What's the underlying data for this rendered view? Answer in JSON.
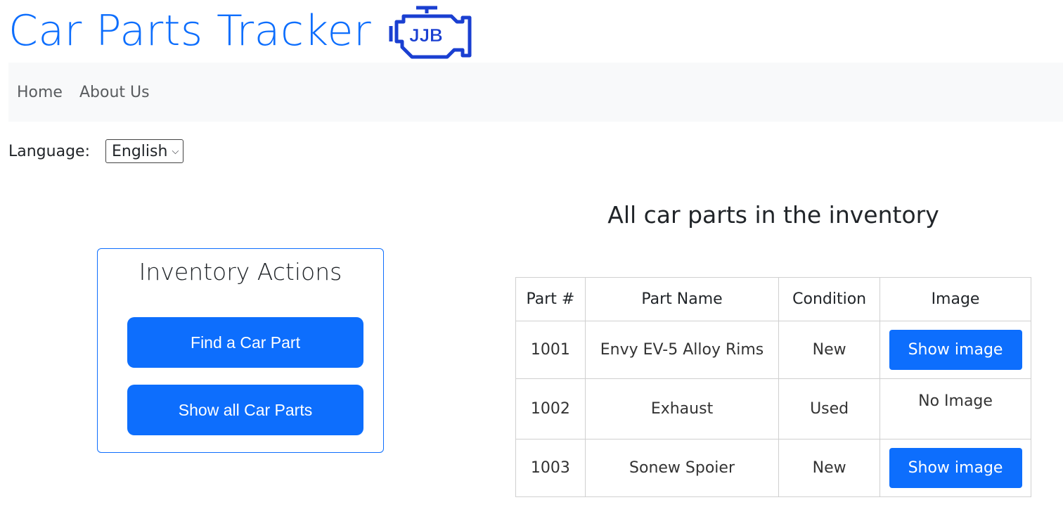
{
  "header": {
    "title": "Car Parts Tracker",
    "logo_text": "JJB"
  },
  "nav": {
    "items": [
      "Home",
      "About Us"
    ]
  },
  "language": {
    "label": "Language:",
    "selected": "English"
  },
  "actions": {
    "title": "Inventory Actions",
    "find_label": "Find a Car Part",
    "show_all_label": "Show all Car Parts"
  },
  "inventory": {
    "heading": "All car parts in the inventory",
    "columns": [
      "Part #",
      "Part Name",
      "Condition",
      "Image"
    ],
    "rows": [
      {
        "part_no": "1001",
        "name": "Envy EV-5 Alloy Rims",
        "condition": "New",
        "image": "Show image"
      },
      {
        "part_no": "1002",
        "name": "Exhaust",
        "condition": "Used",
        "image": "No Image"
      },
      {
        "part_no": "1003",
        "name": "Sonew Spoier",
        "condition": "New",
        "image": "Show image"
      }
    ]
  },
  "colors": {
    "accent": "#0d6efd",
    "logo": "#1a3fd1",
    "navbar_bg": "#f8f9fa"
  }
}
